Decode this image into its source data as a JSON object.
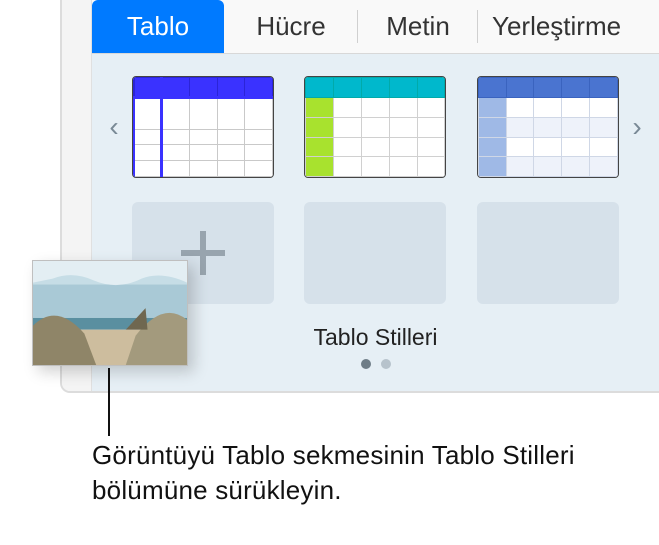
{
  "tabs": {
    "tablo": "Tablo",
    "hucre": "Hücre",
    "metin": "Metin",
    "yerlestirme": "Yerleştirme"
  },
  "styles": {
    "title": "Tablo Stilleri"
  },
  "callout": {
    "text": "Görüntüyü Tablo sekmesinin Tablo Stilleri bölümüne sürükleyin."
  }
}
